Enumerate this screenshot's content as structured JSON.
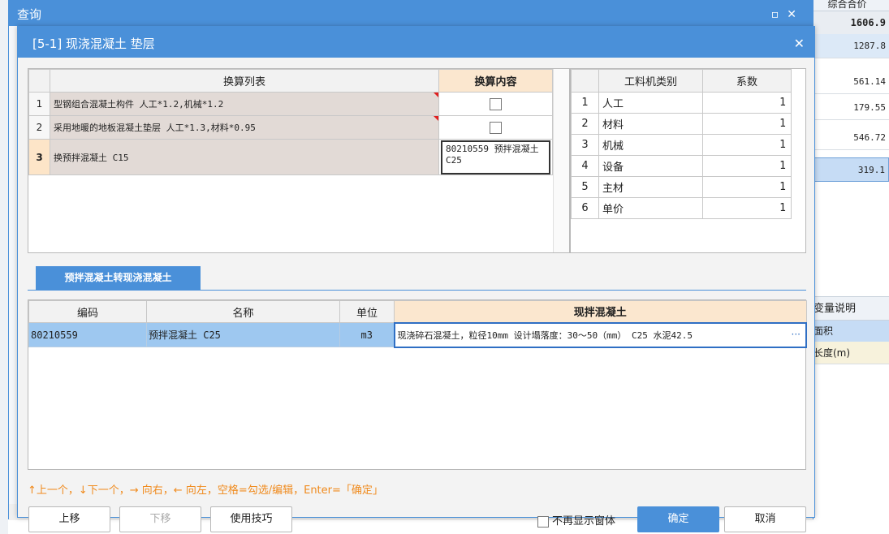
{
  "outer": {
    "title": "查询",
    "min_icon": "▫",
    "close_icon": "✕"
  },
  "background": {
    "header": "综合合价",
    "total": "1606.9",
    "values": [
      "1287.8",
      "561.14",
      "179.55",
      "546.72",
      "319.1"
    ],
    "var_header": "变量说明",
    "var_rows": [
      "面积",
      "长度(m)"
    ]
  },
  "dialog": {
    "title": "[5-1] 现浇混凝土 垫层",
    "close_icon": "✕"
  },
  "conversion": {
    "col_list": "换算列表",
    "col_content": "换算内容",
    "rows": [
      {
        "num": "1",
        "name": "型钢组合混凝土构件 人工*1.2,机械*1.2",
        "content_type": "checkbox"
      },
      {
        "num": "2",
        "name": "采用地暖的地板混凝土垫层 人工*1.3,材料*0.95",
        "content_type": "checkbox"
      },
      {
        "num": "3",
        "name": "换预拌混凝土 C15",
        "content": "80210559  预拌混凝土 C25"
      }
    ]
  },
  "coefficients": {
    "col_category": "工料机类别",
    "col_factor": "系数",
    "rows": [
      {
        "num": "1",
        "category": "人工",
        "factor": "1"
      },
      {
        "num": "2",
        "category": "材料",
        "factor": "1"
      },
      {
        "num": "3",
        "category": "机械",
        "factor": "1"
      },
      {
        "num": "4",
        "category": "设备",
        "factor": "1"
      },
      {
        "num": "5",
        "category": "主材",
        "factor": "1"
      },
      {
        "num": "6",
        "category": "单价",
        "factor": "1"
      }
    ]
  },
  "tab": {
    "label": "预拌混凝土转现浇混凝土"
  },
  "mix": {
    "col_code": "编码",
    "col_name": "名称",
    "col_unit": "单位",
    "col_site": "现拌混凝土",
    "row": {
      "code": "80210559",
      "name": "预拌混凝土 C25",
      "unit": "m3",
      "site": "现浇碎石混凝土，粒径10mm 设计塌落度：30～50（mm） C25 水泥42.5",
      "more": "···"
    }
  },
  "hint": "↑上一个，↓下一个，→ 向右，← 向左，空格=勾选/编辑，Enter=「确定」",
  "buttons": {
    "up": "上移",
    "down": "下移",
    "tips": "使用技巧",
    "no_show": "不再显示窗体",
    "ok": "确定",
    "cancel": "取消"
  }
}
